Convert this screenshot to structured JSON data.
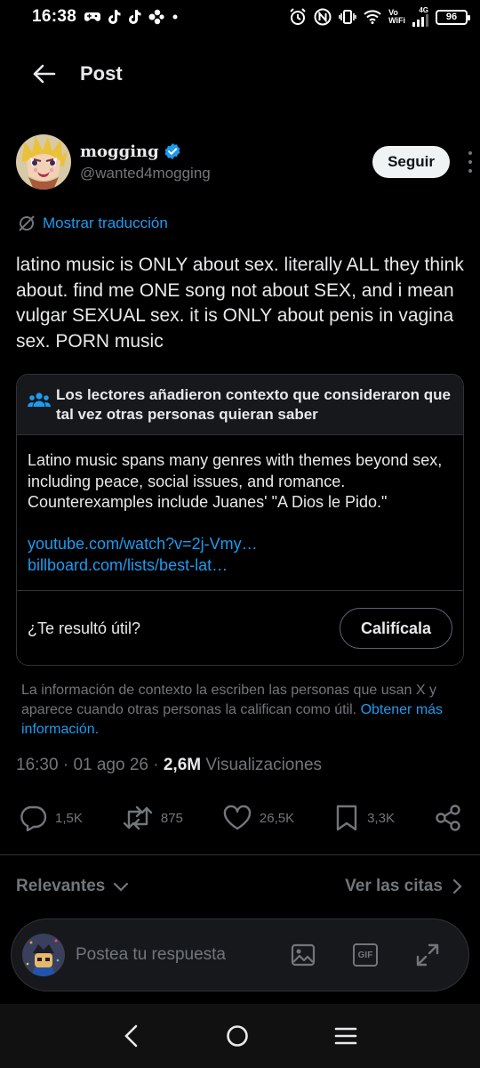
{
  "status_bar": {
    "time": "16:38",
    "vowifi_line1": "Vo",
    "vowifi_line2": "WiFi",
    "network": "4G",
    "battery": "96"
  },
  "header": {
    "title": "Post"
  },
  "author": {
    "display_name": "mogging",
    "handle": "@wanted4mogging",
    "follow_label": "Seguir"
  },
  "translate_label": "Mostrar traducción",
  "tweet_text": "latino music is ONLY about sex. literally ALL they think about. find me ONE song not about SEX, and i mean vulgar SEXUAL sex. it is ONLY about penis in vagina sex. PORN music",
  "community_note": {
    "title": "Los lectores añadieron contexto que consideraron que tal vez otras personas quieran saber",
    "body": "Latino music spans many genres with themes beyond sex, including peace, social issues, and romance. Counterexamples include Juanes' \"A Dios le Pido.\"",
    "links": [
      "youtube.com/watch?v=2j-Vmy…",
      "billboard.com/lists/best-lat…"
    ],
    "question": "¿Te resultó útil?",
    "rate_label": "Califícala",
    "disclaimer": "La información de contexto la escriben las personas que usan X y aparece cuando otras personas la califican como útil.",
    "learn_more": "Obtener más información."
  },
  "meta": {
    "time": "16:30",
    "date": "01 ago 26",
    "views_count": "2,6M",
    "views_label": "Visualizaciones"
  },
  "actions": {
    "replies": "1,5K",
    "reposts": "875",
    "likes": "26,5K",
    "bookmarks": "3,3K"
  },
  "replies_filter": {
    "sort_label": "Relevantes",
    "quotes_label": "Ver las citas"
  },
  "composer": {
    "placeholder": "Postea tu respuesta",
    "gif_label": "GIF"
  },
  "colors": {
    "accent": "#1d9bf0",
    "background": "#000000",
    "secondary_text": "#71767b",
    "border": "#2f3336"
  },
  "icons": {
    "back": "arrow-left-icon",
    "verified": "verified-badge-icon",
    "translate": "translate-icon",
    "note_people": "people-icon",
    "reply": "comment-icon",
    "repost": "repost-icon",
    "like": "heart-icon",
    "bookmark": "bookmark-icon",
    "share": "share-icon",
    "image": "image-icon",
    "gif": "gif-icon",
    "expand": "expand-icon"
  }
}
